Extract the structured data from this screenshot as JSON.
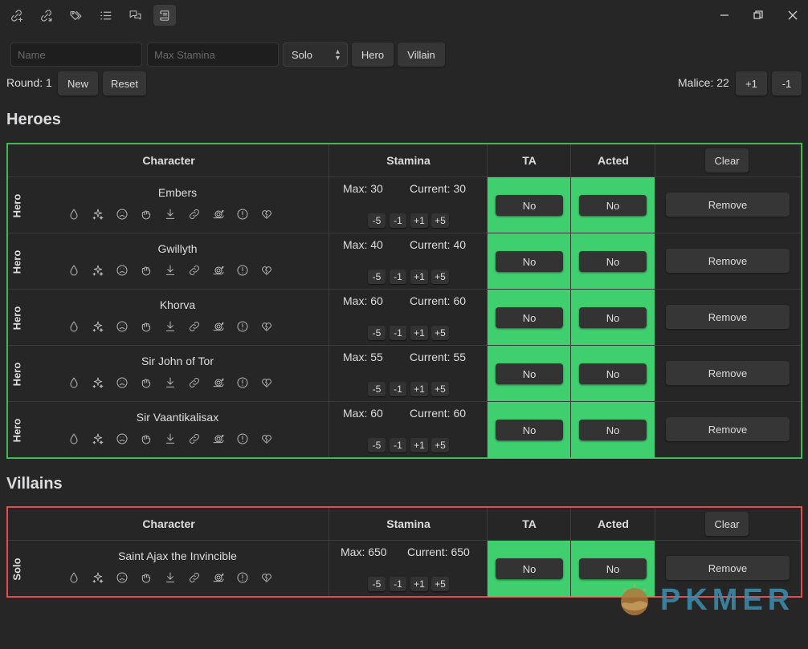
{
  "toolbar": {
    "icons": [
      "link-add-icon",
      "link-out-icon",
      "tags-icon",
      "list-icon",
      "chat-icon",
      "scroll-icon"
    ]
  },
  "form": {
    "name_placeholder": "Name",
    "stamina_placeholder": "Max Stamina",
    "type_select": "Solo",
    "hero_button": "Hero",
    "villain_button": "Villain"
  },
  "round": {
    "label": "Round: 1",
    "new_button": "New",
    "reset_button": "Reset"
  },
  "malice": {
    "label": "Malice: 22",
    "plus_button": "+1",
    "minus_button": "-1"
  },
  "columns": {
    "character": "Character",
    "stamina": "Stamina",
    "ta": "TA",
    "acted": "Acted",
    "clear": "Clear"
  },
  "heroes": {
    "title": "Heroes",
    "rows": [
      {
        "role": "Hero",
        "name": "Embers",
        "max": "Max: 30",
        "current": "Current: 30",
        "ta": "No",
        "acted": "No",
        "remove": "Remove"
      },
      {
        "role": "Hero",
        "name": "Gwillyth",
        "max": "Max: 40",
        "current": "Current: 40",
        "ta": "No",
        "acted": "No",
        "remove": "Remove"
      },
      {
        "role": "Hero",
        "name": "Khorva",
        "max": "Max: 60",
        "current": "Current: 60",
        "ta": "No",
        "acted": "No",
        "remove": "Remove"
      },
      {
        "role": "Hero",
        "name": "Sir John of Tor",
        "max": "Max: 55",
        "current": "Current: 55",
        "ta": "No",
        "acted": "No",
        "remove": "Remove"
      },
      {
        "role": "Hero",
        "name": "Sir Vaantikalisax",
        "max": "Max: 60",
        "current": "Current: 60",
        "ta": "No",
        "acted": "No",
        "remove": "Remove"
      }
    ]
  },
  "villains": {
    "title": "Villains",
    "rows": [
      {
        "role": "Solo",
        "name": "Saint Ajax the Invincible",
        "max": "Max: 650",
        "current": "Current: 650",
        "ta": "No",
        "acted": "No",
        "remove": "Remove"
      }
    ]
  },
  "adjust_buttons": [
    "-5",
    "-1",
    "+1",
    "+5"
  ],
  "condition_icons": [
    "bleeding-icon",
    "dazed-icon",
    "frightened-icon",
    "grabbed-icon",
    "prone-icon",
    "restrained-icon",
    "slowed-icon",
    "taunted-icon",
    "weakened-icon"
  ],
  "watermark": "PKMER",
  "colors": {
    "background": "#262626",
    "hero_border": "#3fb950",
    "villain_border": "#e34c4c",
    "toggle_green": "#3fcf6e"
  }
}
